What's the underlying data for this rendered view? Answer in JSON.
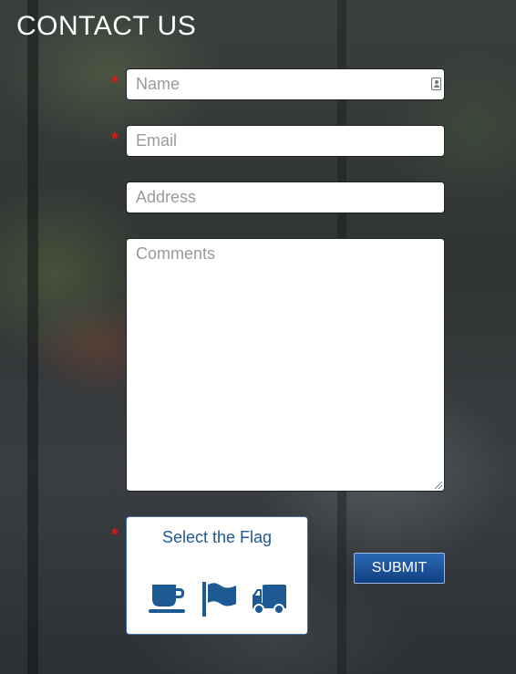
{
  "page": {
    "title": "CONTACT US"
  },
  "form": {
    "required_marker": "*",
    "name": {
      "placeholder": "Name",
      "value": ""
    },
    "email": {
      "placeholder": "Email",
      "value": ""
    },
    "address": {
      "placeholder": "Address",
      "value": ""
    },
    "comments": {
      "placeholder": "Comments",
      "value": ""
    }
  },
  "captcha": {
    "label": "Select the Flag",
    "options": [
      {
        "icon": "coffee-cup-icon"
      },
      {
        "icon": "flag-icon"
      },
      {
        "icon": "truck-icon"
      }
    ]
  },
  "submit": {
    "label": "SUBMIT"
  },
  "colors": {
    "accent": "#1d5a94",
    "required": "#e01818",
    "button_top": "#2a69b5",
    "button_bottom": "#123f82"
  }
}
